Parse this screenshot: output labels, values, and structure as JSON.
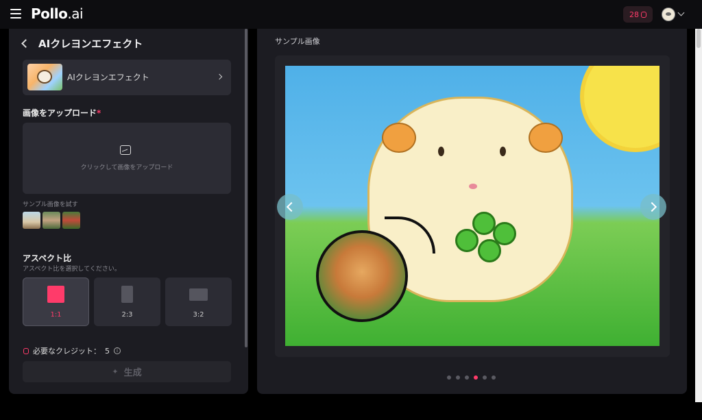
{
  "topbar": {
    "logo_main": "Pollo",
    "logo_ext": ".ai",
    "credits": "28",
    "icons": {
      "menu": "hamburger-icon",
      "coin": "coin-icon",
      "avatar": "avatar",
      "dropdown": "chevron-down-icon"
    }
  },
  "left": {
    "title": "AIクレヨンエフェクト",
    "effect_label": "AIクレヨンエフェクト",
    "upload_heading": "画像をアップロード",
    "required_mark": "*",
    "upload_hint": "クリックして画像をアップロード",
    "sample_label": "サンプル画像を試す",
    "aspect_heading": "アスペクト比",
    "aspect_hint": "アスペクト比を選択してください。",
    "ratios": [
      {
        "label": "1:1",
        "selected": true
      },
      {
        "label": "2:3",
        "selected": false
      },
      {
        "label": "3:2",
        "selected": false
      }
    ],
    "credit_text": "必要なクレジット：",
    "credit_value": "5",
    "generate_label": "生成"
  },
  "right": {
    "title": "サンプル画像",
    "dots": {
      "count": 6,
      "active_index": 3
    }
  },
  "colors": {
    "accent": "#ff3b6a",
    "panel": "#1c1c22",
    "card": "#2c2c34"
  }
}
